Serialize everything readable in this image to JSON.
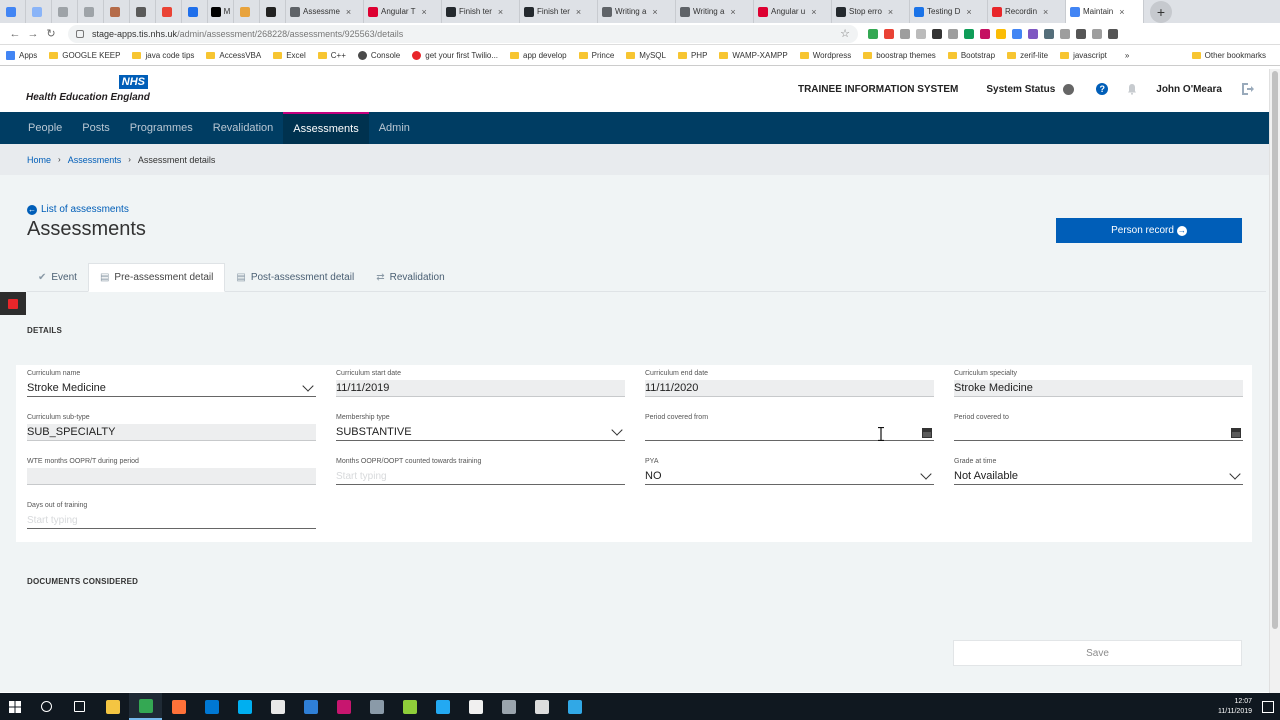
{
  "browser": {
    "tabs": [
      {
        "label": "",
        "color": "#4285f4",
        "size": "small"
      },
      {
        "label": "",
        "color": "#8ab4f8",
        "size": "small"
      },
      {
        "label": "",
        "color": "#9ea3a8",
        "size": "small"
      },
      {
        "label": "",
        "color": "#9ea3a8",
        "size": "small"
      },
      {
        "label": "",
        "color": "#b56c4a",
        "size": "small"
      },
      {
        "label": "",
        "color": "#5a5a5a",
        "size": "small"
      },
      {
        "label": "",
        "color": "#ea4335",
        "size": "small"
      },
      {
        "label": "",
        "color": "#1f6feb",
        "size": "small"
      },
      {
        "label": "M",
        "color": "#000000",
        "size": "small"
      },
      {
        "label": "",
        "color": "#e8a33d",
        "size": "small"
      },
      {
        "label": "",
        "color": "#222222",
        "size": "small"
      },
      {
        "label": "Assessme",
        "color": "#5f6368",
        "size": "medium",
        "close": "×"
      },
      {
        "label": "Angular T",
        "color": "#dd0031",
        "size": "medium",
        "close": "×"
      },
      {
        "label": "Finish ter",
        "color": "#24292e",
        "size": "medium",
        "close": "×"
      },
      {
        "label": "Finish ter",
        "color": "#24292e",
        "size": "medium",
        "close": "×"
      },
      {
        "label": "Writing a",
        "color": "#5f6368",
        "size": "medium",
        "close": "×"
      },
      {
        "label": "Writing a",
        "color": "#5f6368",
        "size": "medium",
        "close": "×"
      },
      {
        "label": "Angular u",
        "color": "#dd0031",
        "size": "medium",
        "close": "×"
      },
      {
        "label": "Stop erro",
        "color": "#24292e",
        "size": "medium",
        "close": "×"
      },
      {
        "label": "Testing D",
        "color": "#1a73e8",
        "size": "medium",
        "close": "×"
      },
      {
        "label": "Recordin",
        "color": "#e8262a",
        "size": "medium",
        "close": "×"
      },
      {
        "label": "Maintain",
        "color": "#4285f4",
        "size": "medium",
        "close": "×",
        "active": true
      }
    ],
    "url_host": "stage-apps.tis.nhs.uk",
    "url_path": "/admin/assessment/268228/assessments/925563/details",
    "bookmarks": [
      {
        "label": "Apps",
        "kind": "apps"
      },
      {
        "label": "GOOGLE KEEP",
        "kind": "folder"
      },
      {
        "label": "java code tips",
        "kind": "folder"
      },
      {
        "label": "AccessVBA",
        "kind": "folder"
      },
      {
        "label": "Excel",
        "kind": "folder"
      },
      {
        "label": "C++",
        "kind": "folder"
      },
      {
        "label": "Console",
        "kind": "site",
        "color": "#4a4a4a"
      },
      {
        "label": "get your first Twilio...",
        "kind": "site",
        "color": "#e8262a"
      },
      {
        "label": "app develop",
        "kind": "folder"
      },
      {
        "label": "Prince",
        "kind": "folder"
      },
      {
        "label": "MySQL",
        "kind": "folder"
      },
      {
        "label": "PHP",
        "kind": "folder"
      },
      {
        "label": "WAMP-XAMPP",
        "kind": "folder"
      },
      {
        "label": "Wordpress",
        "kind": "folder"
      },
      {
        "label": "boostrap themes",
        "kind": "folder"
      },
      {
        "label": "Bootstrap",
        "kind": "folder"
      },
      {
        "label": "zerif-lite",
        "kind": "folder"
      },
      {
        "label": "javascript",
        "kind": "folder"
      }
    ],
    "bookmarks_more": "»",
    "other_bookmarks": "Other bookmarks",
    "extension_colors": [
      "#34a853",
      "#e94235",
      "#9e9e9e",
      "#bbbbbb",
      "#333333",
      "#9e9e9e",
      "#0f9d58",
      "#c51162",
      "#fbbc05",
      "#4285f4",
      "#7e57c2",
      "#546e7a",
      "#9e9e9e",
      "#555555",
      "#9e9e9e",
      "#555555"
    ]
  },
  "header": {
    "brand": "NHS",
    "org": "Health Education England",
    "system_title": "TRAINEE INFORMATION SYSTEM",
    "system_status": "System Status",
    "help": "?",
    "user": "John O'Meara"
  },
  "nav": {
    "items": [
      {
        "label": "People",
        "active": false
      },
      {
        "label": "Posts",
        "active": false
      },
      {
        "label": "Programmes",
        "active": false
      },
      {
        "label": "Revalidation",
        "active": false
      },
      {
        "label": "Assessments",
        "active": true
      },
      {
        "label": "Admin",
        "active": false
      }
    ]
  },
  "breadcrumb": {
    "home": "Home",
    "assessments": "Assessments",
    "current": "Assessment details",
    "separator": "›"
  },
  "page": {
    "back_link": "List of assessments",
    "title": "Assessments",
    "person_record": "Person record"
  },
  "tabs": [
    {
      "label": "Event",
      "icon": "check-icon",
      "glyph": "✔",
      "active": false
    },
    {
      "label": "Pre-assessment detail",
      "icon": "document-icon",
      "glyph": "▤",
      "active": true
    },
    {
      "label": "Post-assessment detail",
      "icon": "document-icon",
      "glyph": "▤",
      "active": false
    },
    {
      "label": "Revalidation",
      "icon": "retweet-icon",
      "glyph": "⇄",
      "active": false
    }
  ],
  "details_title": "DETAILS",
  "fields": {
    "curriculum_name": {
      "label": "Curriculum name",
      "value": "Stroke Medicine"
    },
    "curriculum_start": {
      "label": "Curriculum start date",
      "value": "11/11/2019"
    },
    "curriculum_end": {
      "label": "Curriculum end date",
      "value": "11/11/2020"
    },
    "curriculum_specialty": {
      "label": "Curriculum specialty",
      "value": "Stroke Medicine"
    },
    "curriculum_subtype": {
      "label": "Curriculum sub-type",
      "value": "SUB_SPECIALTY"
    },
    "membership_type": {
      "label": "Membership type",
      "value": "SUBSTANTIVE"
    },
    "period_from": {
      "label": "Period covered from",
      "value": ""
    },
    "period_to": {
      "label": "Period covered to",
      "value": ""
    },
    "wte_months": {
      "label": "WTE months OOPR/T during period",
      "value": ""
    },
    "months_oopr": {
      "label": "Months OOPR/OOPT counted towards training",
      "placeholder": "Start typing"
    },
    "pya": {
      "label": "PYA",
      "value": "NO"
    },
    "grade": {
      "label": "Grade at time",
      "value": "Not Available"
    },
    "days_out": {
      "label": "Days out of training",
      "placeholder": "Start typing"
    }
  },
  "documents_title": "DOCUMENTS CONSIDERED",
  "save_label": "Save",
  "taskbar": {
    "time": "12:07",
    "date": "11/11/2019",
    "apps": [
      {
        "name": "search-icon",
        "color": "#ffffff"
      },
      {
        "name": "task-view-icon",
        "color": "#ffffff"
      },
      {
        "name": "file-explorer-icon",
        "color": "#f4c542"
      },
      {
        "name": "chrome-icon",
        "color": "#34a853",
        "active": true
      },
      {
        "name": "firefox-icon",
        "color": "#ff7139"
      },
      {
        "name": "outlook-icon",
        "color": "#0078d4"
      },
      {
        "name": "skype-icon",
        "color": "#00aff0"
      },
      {
        "name": "slack-icon",
        "color": "#e8e8e8"
      },
      {
        "name": "vscode-blue-icon",
        "color": "#2f7fd6"
      },
      {
        "name": "intellij-icon",
        "color": "#c7166f"
      },
      {
        "name": "sourcetree-icon",
        "color": "#8a9aa8"
      },
      {
        "name": "notepadpp-icon",
        "color": "#8fce3a"
      },
      {
        "name": "vscode-icon",
        "color": "#23a9f2"
      },
      {
        "name": "photos-icon",
        "color": "#f0f0f0"
      },
      {
        "name": "git-icon",
        "color": "#9aa4ad"
      },
      {
        "name": "terminal-icon",
        "color": "#dddddd"
      },
      {
        "name": "recorder-icon",
        "color": "#31a8e6"
      }
    ]
  }
}
